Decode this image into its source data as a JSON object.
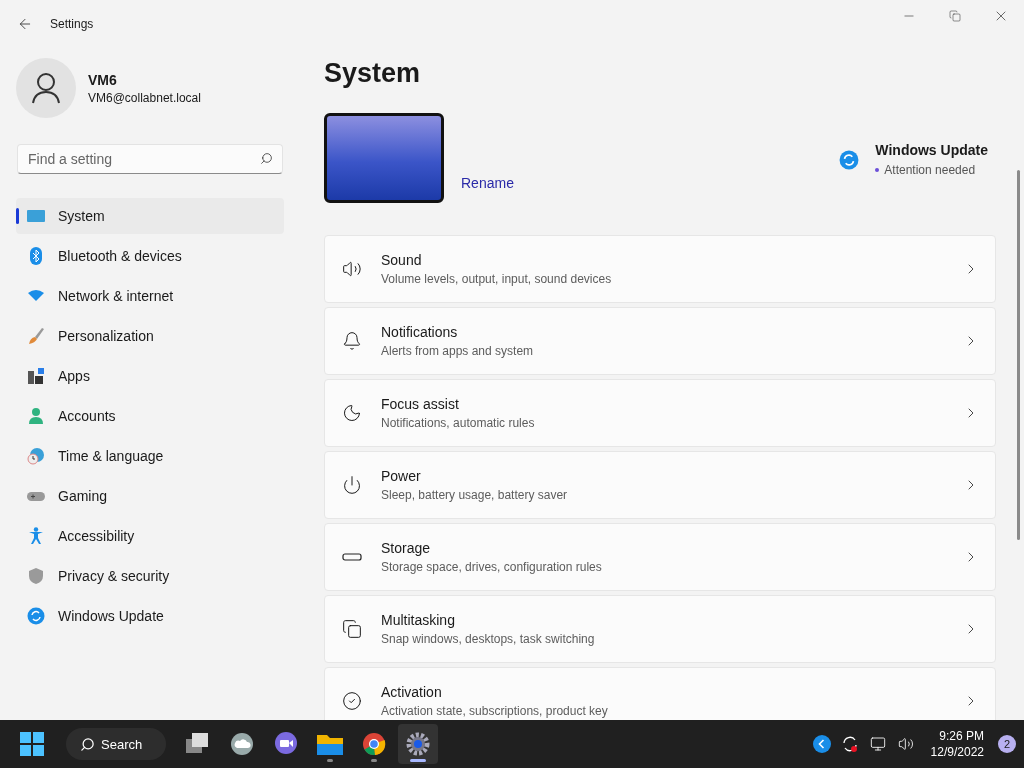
{
  "window": {
    "title": "Settings"
  },
  "user": {
    "name": "VM6",
    "email": "VM6@collabnet.local"
  },
  "search": {
    "placeholder": "Find a setting"
  },
  "sidebar": {
    "items": [
      {
        "label": "System",
        "selected": true
      },
      {
        "label": "Bluetooth & devices",
        "selected": false
      },
      {
        "label": "Network & internet",
        "selected": false
      },
      {
        "label": "Personalization",
        "selected": false
      },
      {
        "label": "Apps",
        "selected": false
      },
      {
        "label": "Accounts",
        "selected": false
      },
      {
        "label": "Time & language",
        "selected": false
      },
      {
        "label": "Gaming",
        "selected": false
      },
      {
        "label": "Accessibility",
        "selected": false
      },
      {
        "label": "Privacy & security",
        "selected": false
      },
      {
        "label": "Windows Update",
        "selected": false
      }
    ]
  },
  "page": {
    "title": "System"
  },
  "device": {
    "rename": "Rename"
  },
  "update": {
    "title": "Windows Update",
    "status": "Attention needed"
  },
  "settings": [
    {
      "title": "Sound",
      "subtitle": "Volume levels, output, input, sound devices"
    },
    {
      "title": "Notifications",
      "subtitle": "Alerts from apps and system"
    },
    {
      "title": "Focus assist",
      "subtitle": "Notifications, automatic rules"
    },
    {
      "title": "Power",
      "subtitle": "Sleep, battery usage, battery saver"
    },
    {
      "title": "Storage",
      "subtitle": "Storage space, drives, configuration rules"
    },
    {
      "title": "Multitasking",
      "subtitle": "Snap windows, desktops, task switching"
    },
    {
      "title": "Activation",
      "subtitle": "Activation state, subscriptions, product key"
    }
  ],
  "taskbar": {
    "search": "Search",
    "apps": [
      {
        "selected": false
      },
      {
        "selected": false
      },
      {
        "selected": false
      },
      {
        "selected": false
      },
      {
        "selected": false
      },
      {
        "selected": true
      }
    ]
  },
  "tray": {
    "time": "9:26 PM",
    "date": "12/9/2022",
    "notifications": "2"
  }
}
